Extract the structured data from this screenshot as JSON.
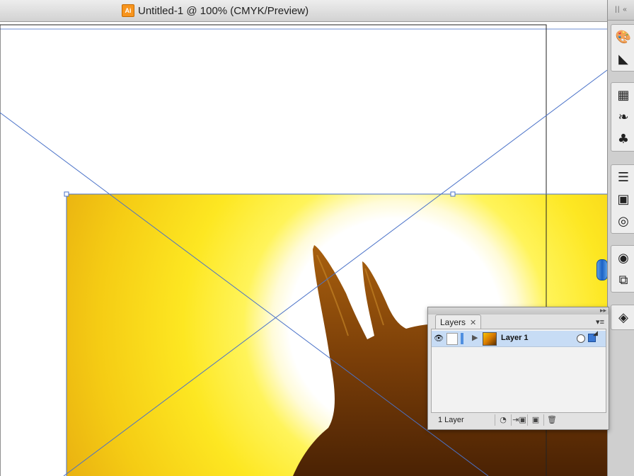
{
  "window": {
    "title": "Untitled-1 @ 100% (CMYK/Preview)",
    "doc_icon_text": "Ai",
    "doc_icon_color": "#f7941d"
  },
  "dock": {
    "grip": "|| «",
    "groups": [
      [
        {
          "name": "color-palette-icon",
          "glyph": "🎨"
        },
        {
          "name": "gradient-icon",
          "glyph": "◣"
        }
      ],
      [
        {
          "name": "swatches-icon",
          "glyph": "▦"
        },
        {
          "name": "brushes-icon",
          "glyph": "❧"
        },
        {
          "name": "symbols-icon",
          "glyph": "♣"
        }
      ],
      [
        {
          "name": "stroke-icon",
          "glyph": "☰"
        },
        {
          "name": "transparency-icon",
          "glyph": "▣"
        },
        {
          "name": "appearance-icon",
          "glyph": "◎"
        }
      ],
      [
        {
          "name": "graphic-styles-icon",
          "glyph": "◉"
        },
        {
          "name": "transform-icon",
          "glyph": "⧉"
        }
      ],
      [
        {
          "name": "layers-icon",
          "glyph": "◈"
        }
      ]
    ]
  },
  "layers_panel": {
    "tab_label": "Layers",
    "tab_close": "✕",
    "collapse_glyph": "▸▸",
    "menu_glyph": "▾≡",
    "layers": [
      {
        "name": "Layer 1",
        "color": "#4f8fe0"
      }
    ],
    "footer_count": "1 Layer",
    "footer_buttons": [
      {
        "name": "make-clip-mask-button",
        "glyph": "◔"
      },
      {
        "name": "new-sublayer-button",
        "glyph": "⇥▣"
      },
      {
        "name": "new-layer-button",
        "glyph": "▣"
      },
      {
        "name": "delete-layer-button",
        "glyph": "🗑"
      }
    ]
  },
  "colors": {
    "guide": "#4a72c8",
    "layer_selection": "#c7dcf5",
    "scroll_thumb": "#1b62c4"
  }
}
